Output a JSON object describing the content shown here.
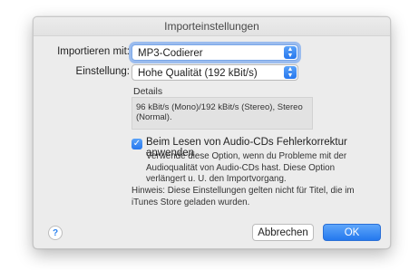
{
  "window": {
    "title": "Importeinstellungen"
  },
  "import_with": {
    "label": "Importieren mit:",
    "value": "MP3-Codierer"
  },
  "setting": {
    "label": "Einstellung:",
    "value": "Hohe Qualität (192 kBit/s)"
  },
  "details": {
    "label": "Details",
    "text": "96 kBit/s (Mono)/192 kBit/s (Stereo), Stereo (Normal)."
  },
  "error_correction": {
    "checked": true,
    "label": "Beim Lesen von Audio-CDs Fehlerkorrektur anwenden",
    "description": "Verwende diese Option, wenn du Probleme mit der Audioqualität von Audio-CDs hast. Diese Option verlängert u. U. den Importvorgang."
  },
  "hint": "Hinweis: Diese Einstellungen gelten nicht für Titel, die im iTunes Store geladen wurden.",
  "buttons": {
    "help": "?",
    "cancel": "Abbrechen",
    "ok": "OK"
  },
  "icons": {
    "stepper": "chevron-updown-icon",
    "checkbox": "checkmark-icon",
    "help": "question-mark-icon"
  },
  "colors": {
    "accent": "#2677ee",
    "dialog_bg": "#ececec"
  }
}
